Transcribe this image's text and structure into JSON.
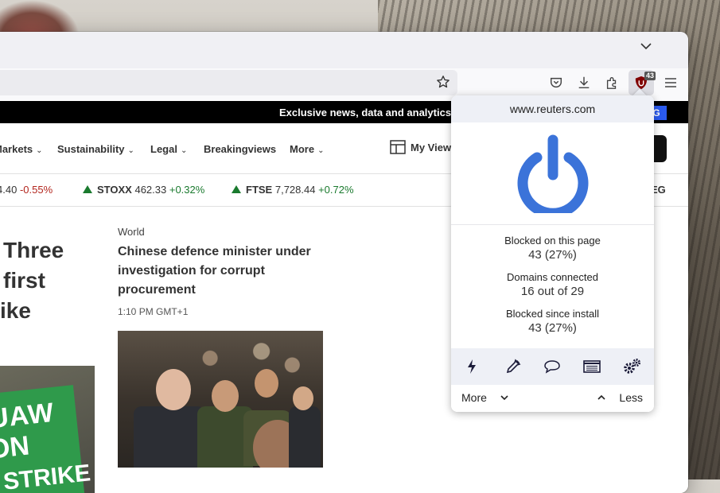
{
  "browser": {
    "badge_count": "43"
  },
  "promo": {
    "text": "Exclusive news, data and analytics",
    "cta": "G"
  },
  "nav": {
    "items": [
      "Markets",
      "Sustainability",
      "Legal",
      "Breakingviews",
      "More"
    ],
    "my_view": "My View"
  },
  "ticker": {
    "items": [
      {
        "value": "4.40",
        "change": "-0.55%",
        "direction": "down"
      },
      {
        "name": "STOXX",
        "value": "462.33",
        "change": "+0.32%",
        "direction": "up"
      },
      {
        "name": "FTSE",
        "value": "7,728.44",
        "change": "+0.72%",
        "direction": "up"
      }
    ],
    "tail": "EG"
  },
  "lead_story": {
    "headline_lines": [
      "Three",
      "first",
      "ike"
    ]
  },
  "uaw_sign": {
    "line1": "UAW",
    "line2": "ON",
    "line3": "STRIKE"
  },
  "story": {
    "kicker": "World",
    "headline": "Chinese defence minister under investigation for corrupt procurement",
    "time": "1:10 PM GMT+1"
  },
  "popup": {
    "hostname": "www.reuters.com",
    "power_color": "#3b73d9",
    "stats": [
      {
        "label": "Blocked on this page",
        "value": "43 (27%)"
      },
      {
        "label": "Domains connected",
        "value": "16 out of 29"
      },
      {
        "label": "Blocked since install",
        "value": "43 (27%)"
      }
    ],
    "tools": [
      "lightning-icon",
      "eyedropper-icon",
      "speech-bubble-icon",
      "list-icon",
      "cogs-icon"
    ],
    "more_label": "More",
    "less_label": "Less"
  }
}
